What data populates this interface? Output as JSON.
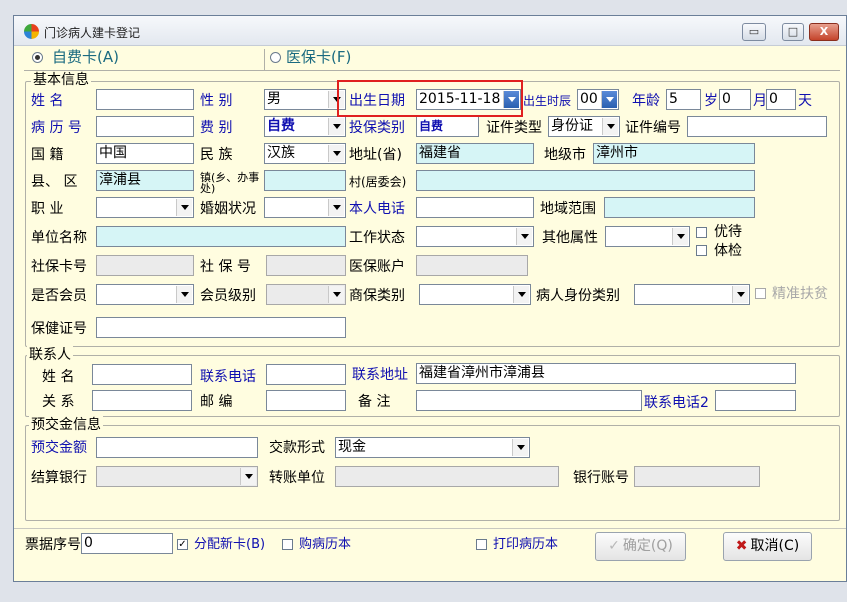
{
  "window": {
    "title": "门诊病人建卡登记",
    "min": "▭",
    "max": "□",
    "close": "X"
  },
  "tabs": {
    "self_pay": "自费卡(A)",
    "insurance": "医保卡(F)"
  },
  "basic": {
    "group_title": "基本信息",
    "name_label": "姓    名",
    "name_value": "",
    "gender_label": "性    别",
    "gender_value": "男",
    "birth_label": "出生日期",
    "birth_value": "2015-11-18",
    "birth_hour_label": "出生时辰",
    "birth_hour_value": "00",
    "age_label": "年龄",
    "age_value": "5",
    "sui": "岁",
    "month_value": "0",
    "yue": "月",
    "day_value": "0",
    "tian": "天",
    "record_label": "病 历 号",
    "record_value": "",
    "fee_label": "费    别",
    "fee_value": "自费",
    "ins_type_label": "投保类别",
    "ins_type_value": "自费",
    "id_type_label": "证件类型",
    "id_type_value": "身份证",
    "id_no_label": "证件编号",
    "id_no_value": "",
    "nation_label": "国    籍",
    "nation_value": "中国",
    "ethnic_label": "民    族",
    "ethnic_value": "汉族",
    "province_label": "地址(省)",
    "province_value": "福建省",
    "city_label": "地级市",
    "city_value": "漳州市",
    "county_label": "县、 区",
    "county_value": "漳浦县",
    "town_label": "镇(乡、办事处)",
    "town_value": "",
    "village_label": "村(居委会)",
    "village_value": "",
    "job_label": "职    业",
    "job_value": "",
    "marital_label": "婚姻状况",
    "marital_value": "",
    "phone_label": "本人电话",
    "phone_value": "",
    "region_label": "地域范围",
    "region_value": "",
    "employer_label": "单位名称",
    "employer_value": "",
    "work_status_label": "工作状态",
    "work_status_value": "",
    "other_attr_label": "其他属性",
    "other_attr_value": "",
    "priority_label": "优待",
    "checkup_label": "体检",
    "social_card_label": "社保卡号",
    "social_card_value": "",
    "social_no_label": "社 保 号",
    "social_no_value": "",
    "ins_account_label": "医保账户",
    "ins_account_value": "",
    "member_label": "是否会员",
    "member_value": "",
    "member_level_label": "会员级别",
    "member_level_value": "",
    "commercial_label": "商保类别",
    "commercial_value": "",
    "patient_type_label": "病人身份类别",
    "patient_type_value": "",
    "poverty_label": "精准扶贫",
    "health_no_label": "保健证号",
    "health_no_value": ""
  },
  "contact": {
    "group_title": "联系人",
    "name_label": "姓    名",
    "name_value": "",
    "phone_label": "联系电话",
    "phone_value": "",
    "address_label": "联系地址",
    "address_value": "福建省漳州市漳浦县",
    "relation_label": "关    系",
    "relation_value": "",
    "zip_label": "邮    编",
    "zip_value": "",
    "note_label": "备    注",
    "note_value": "",
    "phone2_label": "联系电话2",
    "phone2_value": ""
  },
  "deposit": {
    "group_title": "预交金信息",
    "amount_label": "预交金额",
    "amount_value": "",
    "pay_type_label": "交款形式",
    "pay_type_value": "现金",
    "bank_label": "结算银行",
    "bank_value": "",
    "transfer_label": "转账单位",
    "transfer_value": "",
    "account_label": "银行账号",
    "account_value": ""
  },
  "footer": {
    "ticket_label": "票据序号",
    "ticket_value": "0",
    "new_card_label": "分配新卡(B)",
    "buy_book_label": "购病历本",
    "print_book_label": "打印病历本",
    "ok_label": "确定(Q)",
    "cancel_label": "取消(C)",
    "ok_icon": "✓",
    "cancel_icon": "✖",
    "check_mark": "✓"
  }
}
